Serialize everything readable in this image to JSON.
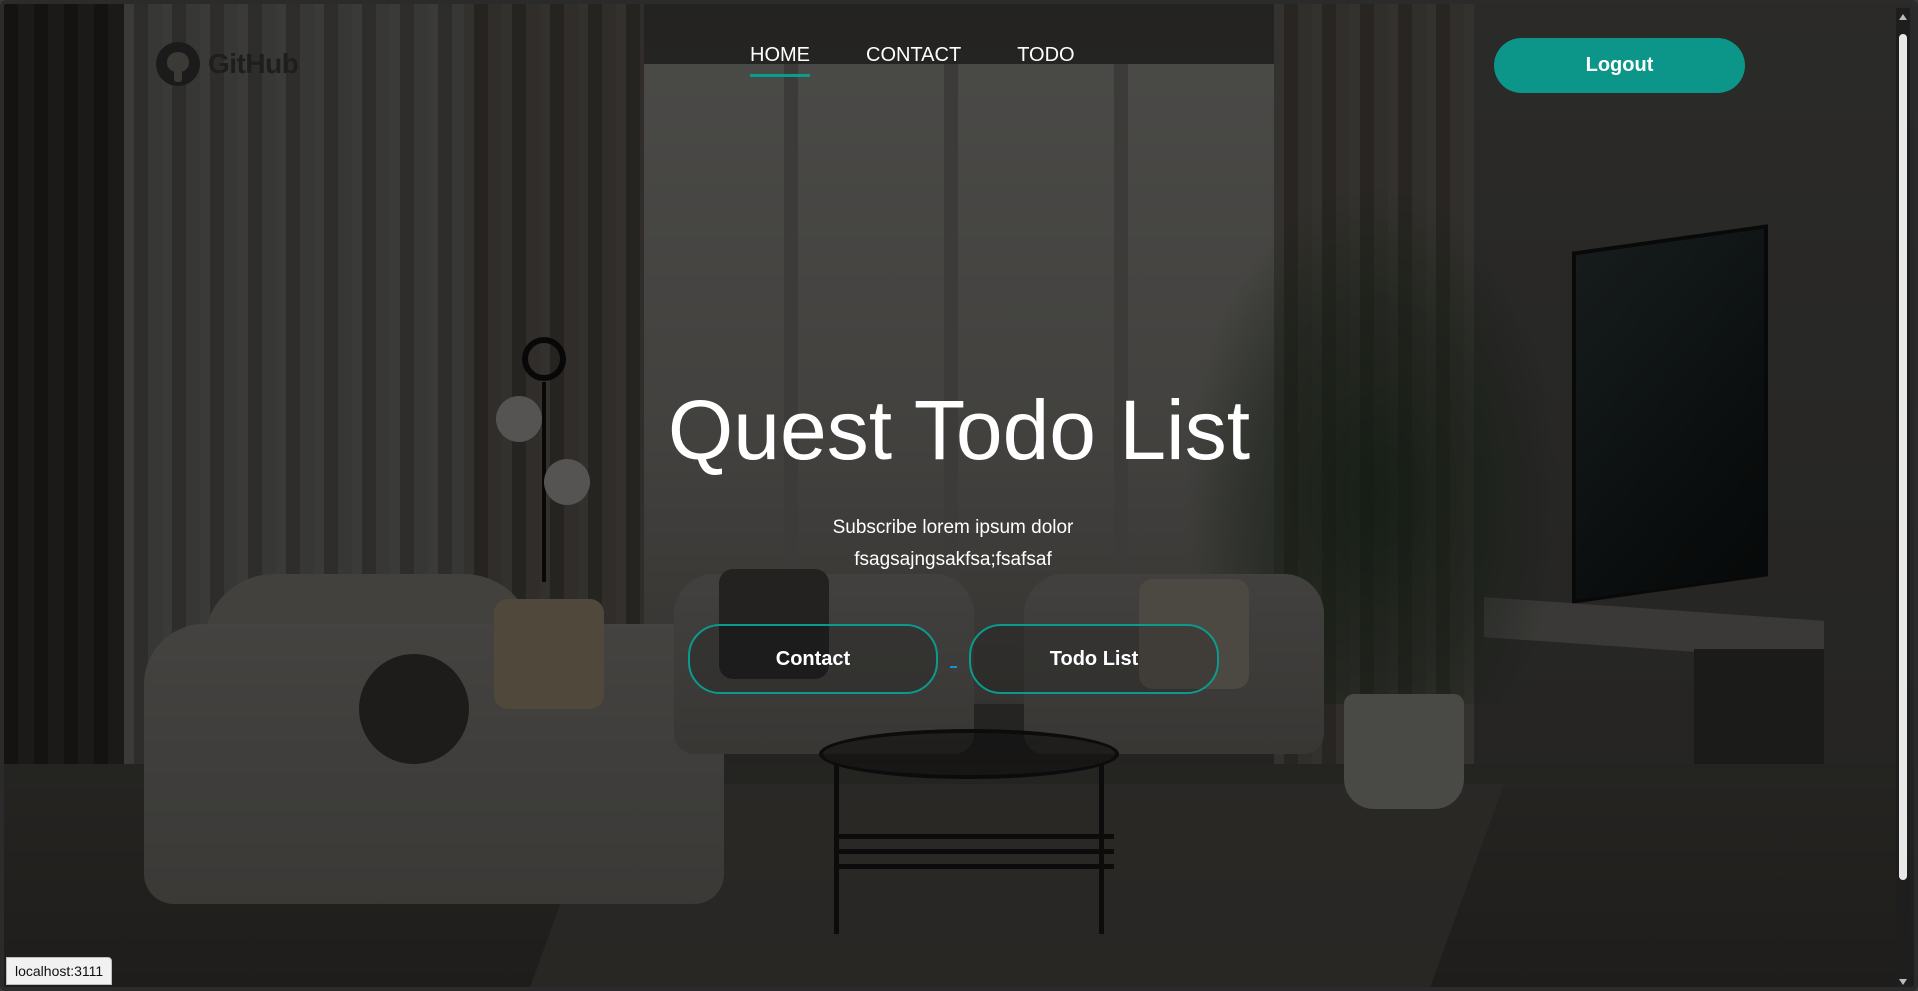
{
  "header": {
    "logo_text": "GitHub",
    "nav": [
      {
        "label": "HOME",
        "active": true
      },
      {
        "label": "CONTACT",
        "active": false
      },
      {
        "label": "TODO",
        "active": false
      }
    ],
    "logout_label": "Logout"
  },
  "hero": {
    "title": "Quest Todo List",
    "subtitle_line1": "Subscribe lorem ipsum dolor",
    "subtitle_line2": "fsagsajngsakfsa;fsafsaf",
    "contact_button": "Contact",
    "todo_button": "Todo List"
  },
  "status_bar": {
    "url": "localhost:3111"
  },
  "colors": {
    "accent": "#0b9689",
    "nav_text": "#ffffff",
    "background_overlay": "#000000"
  },
  "icons": {
    "logo": "github-icon"
  }
}
